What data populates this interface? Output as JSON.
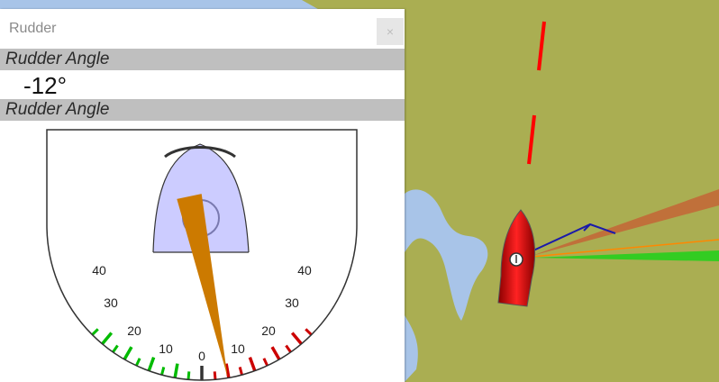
{
  "panel": {
    "title": "Rudder",
    "close_icon": "close-icon",
    "header_top": "Rudder Angle",
    "value_text": "-12°",
    "header_bottom": "Rudder Angle"
  },
  "gauge": {
    "rudder_angle_deg": -12,
    "scale_max": 45,
    "labels_left": [
      "40",
      "30",
      "20",
      "10",
      "0"
    ],
    "labels_right": [
      "10",
      "20",
      "30",
      "40"
    ],
    "port_color": "#cc0000",
    "starboard_color": "#00bb00",
    "pointer_color": "#cc7a00",
    "boat_shape_color": "#ccccff"
  },
  "map": {
    "land_color": "#aaae52",
    "water_color": "#a8c4e8",
    "boat_color": "#cc0000"
  }
}
